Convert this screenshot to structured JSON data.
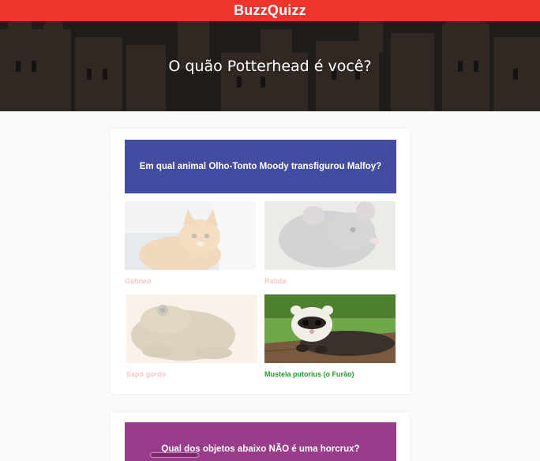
{
  "header": {
    "brand": "BuzzQuizz"
  },
  "quiz": {
    "title": "O quão Potterhead é você?"
  },
  "questions": [
    {
      "text": "Em qual animal Olho-Tonto Moody transfigurou Malfoy?",
      "color": "#434ca0",
      "options": [
        {
          "label": "Gatineo",
          "image": "orange-cat-photo",
          "state": "wrong"
        },
        {
          "label": "Ratata",
          "image": "grey-rat-photo",
          "state": "wrong"
        },
        {
          "label": "Sapo gordo",
          "image": "toad-photo",
          "state": "wrong"
        },
        {
          "label": "Mustela putorius (o Furão)",
          "image": "ferret-photo",
          "state": "correct"
        }
      ]
    },
    {
      "text": "Qual dos objetos abaixo NÃO é uma horcrux?",
      "color": "#993d8b"
    }
  ],
  "colors": {
    "brand": "#ec362d",
    "correct": "#1f9b2c",
    "wrong": "#fbc6c6"
  }
}
